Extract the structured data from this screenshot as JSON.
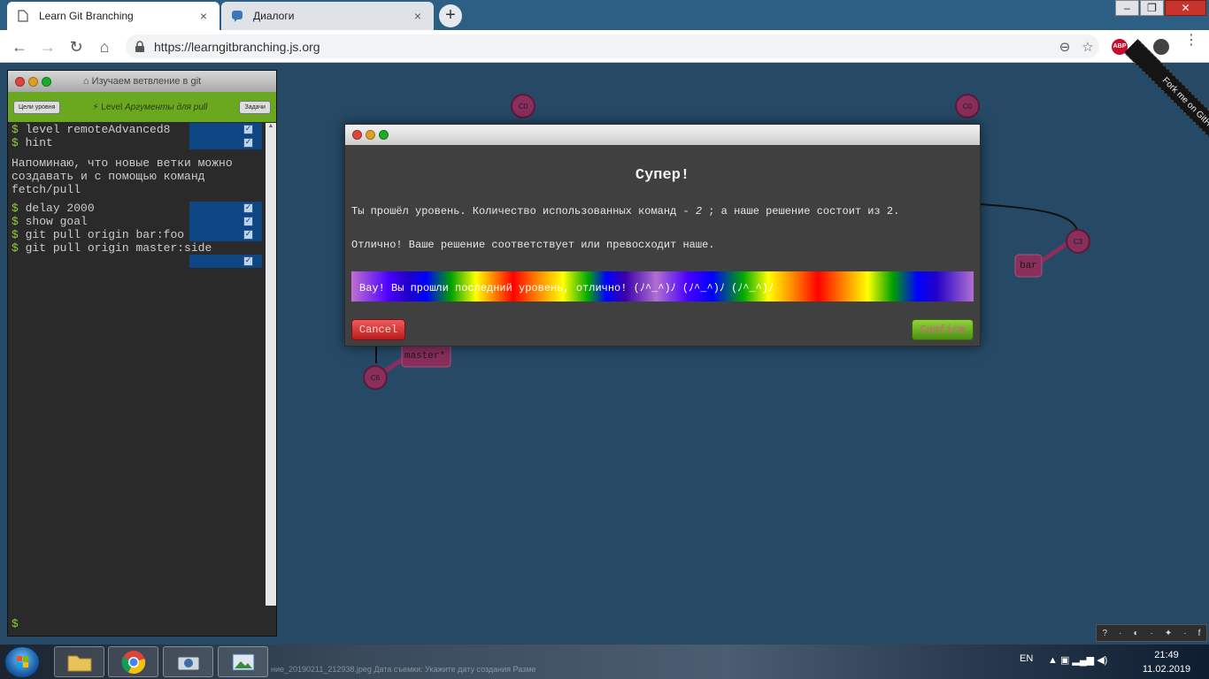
{
  "browser": {
    "tabs": [
      {
        "title": "Learn Git Branching",
        "icon": "page-icon",
        "active": true
      },
      {
        "title": "Диалоги",
        "icon": "chat-icon",
        "active": false
      }
    ],
    "new_tab_label": "+",
    "close_tab_label": "×",
    "window_controls": {
      "minimize": "‒",
      "maximize": "❐",
      "close": "✕"
    },
    "url": "https://learngitbranching.js.org",
    "nav": {
      "back": "←",
      "forward": "→",
      "reload": "↻",
      "home": "⌂"
    },
    "omnibox_buttons": {
      "zoom": "⊖",
      "bookmark": "☆"
    },
    "extension_abp": "ABP",
    "menu": "⋮"
  },
  "terminal": {
    "title": "Изучаем ветвление в git",
    "title_icon": "home-icon",
    "level_button": "Цели уровня",
    "level_prefix": "Level",
    "level_name": "Аргументы для pull",
    "task_button": "Задачи",
    "commands_a": [
      "level remoteAdvanced8",
      "hint"
    ],
    "hint_text": "Напоминаю, что новые ветки можно\nсоздавать и с помощью команд\nfetch/pull",
    "commands_b": [
      "delay 2000",
      "show goal",
      "git pull origin bar:foo",
      "git pull origin master:side"
    ],
    "prompt": "$"
  },
  "visualization": {
    "nodes": [
      "C0",
      "C0",
      "C3",
      "C6"
    ],
    "branches": [
      "bar",
      "master*"
    ]
  },
  "fork_ribbon": "Fork me on GitHub",
  "modal": {
    "title": "Супер!",
    "line1_before": "Ты прошёл уровень. Количество использованных команд - ",
    "line1_count": "2",
    "line1_after": " ; а наше решение состоит из 2.",
    "line2": "Отлично! Ваше решение соответствует или превосходит наше.",
    "banner": "Вау! Вы прошли последний уровень, отлично! (ﾉ^_^)ﾉ (ﾉ^_^)ﾉ (ﾉ^_^)ﾉ",
    "cancel": "Cancel",
    "confirm": "Confirm"
  },
  "helpbar": [
    "?",
    "·",
    "◐",
    "·",
    "✦",
    "·",
    "f"
  ],
  "taskbar": {
    "ghost_text": "ние_20190211_212938.jpeg     Дата съемки: Укажите дату создания     Разме",
    "language": "EN",
    "time": "21:49",
    "date": "11.02.2019"
  }
}
